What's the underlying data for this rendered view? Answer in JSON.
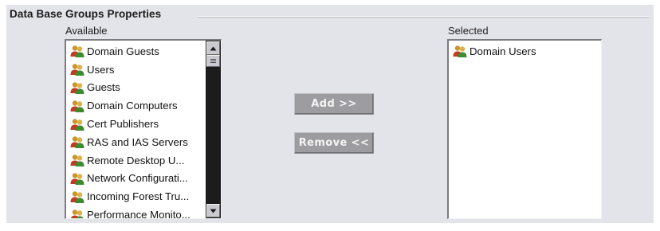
{
  "group": {
    "title": "Data Base Groups Properties"
  },
  "available": {
    "label": "Available",
    "items": [
      "Domain Guests",
      "Users",
      "Guests",
      "Domain Computers",
      "Cert Publishers",
      "RAS and IAS Servers",
      "Remote Desktop U...",
      "Network Configurati...",
      "Incoming Forest Tru...",
      "Performance Monito..."
    ]
  },
  "selected": {
    "label": "Selected",
    "items": [
      "Domain Users"
    ]
  },
  "actions": {
    "add_label": "Add >>",
    "remove_label": "Remove <<"
  },
  "icons": {
    "group_item": "user-group-icon",
    "scroll_up": "arrow-up-icon",
    "scroll_down": "arrow-down-icon"
  },
  "colors": {
    "frame_bg": "#e3e3ea",
    "button_bg": "#9d9da1",
    "scrollbar_track": "#1c1c1c"
  }
}
